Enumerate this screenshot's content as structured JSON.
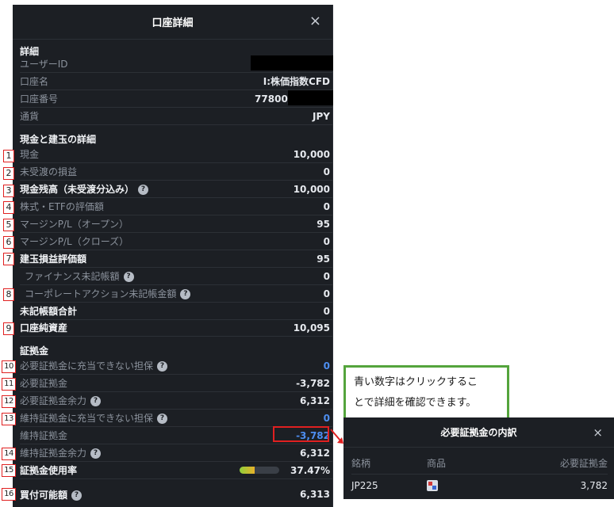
{
  "account_detail": {
    "title": "口座詳細",
    "close_label": "×",
    "sections": {
      "details": "詳細",
      "cash": "現金と建玉の詳細",
      "margin": "証拠金"
    },
    "details_rows": [
      {
        "label": "ユーザーID",
        "value": ""
      },
      {
        "label": "口座名",
        "value": "I:株価指数CFD"
      },
      {
        "label": "口座番号",
        "value": "77800/I1"
      },
      {
        "label": "通貨",
        "value": "JPY"
      }
    ],
    "cash_rows": [
      {
        "badge": "1",
        "label": "現金",
        "value": "10,000"
      },
      {
        "badge": "2",
        "label": "未受渡の損益",
        "value": "0"
      },
      {
        "badge": "3",
        "label": "現金残高（未受渡分込み）",
        "value": "10,000"
      },
      {
        "badge": "4",
        "label": "株式・ETFの評価額",
        "value": "0"
      },
      {
        "badge": "5",
        "label": "マージンP/L（オープン）",
        "value": "95"
      },
      {
        "badge": "6",
        "label": "マージンP/L（クローズ）",
        "value": "0"
      },
      {
        "badge": "7",
        "label": "建玉損益評価額",
        "value": "95"
      },
      {
        "badge": "",
        "label": "ファイナンス未記帳額",
        "value": "0"
      },
      {
        "badge": "8",
        "label": "コーポレートアクション未記帳金額",
        "value": "0"
      },
      {
        "badge": "",
        "label": "未記帳額合計",
        "value": "0"
      },
      {
        "badge": "9",
        "label": "口座純資産",
        "value": "10,095"
      }
    ],
    "margin_rows": [
      {
        "badge": "10",
        "label": "必要証拠金に充当できない担保",
        "value": "0"
      },
      {
        "badge": "11",
        "label": "必要証拠金",
        "value": "-3,782"
      },
      {
        "badge": "12",
        "label": "必要証拠金余力",
        "value": "6,312"
      },
      {
        "badge": "13",
        "label": "維持証拠金に充当できない担保",
        "value": "0"
      },
      {
        "badge": "",
        "label": "維持証拠金",
        "value": "-3,782"
      },
      {
        "badge": "14",
        "label": "維持証拠金余力",
        "value": "6,312"
      },
      {
        "badge": "15",
        "label": "証拠金使用率",
        "value": "37.47%"
      },
      {
        "badge": "16",
        "label": "買付可能額",
        "value": "6,313"
      }
    ],
    "margin_usage_fraction": 0.3747,
    "help_icon": "?"
  },
  "note": {
    "text_line1": "青い数字はクリックするこ",
    "text_line2": "とで詳細を確認できます。"
  },
  "popup": {
    "title": "必要証拠金の内訳",
    "close_label": "×",
    "headers": [
      "銘柄",
      "商品",
      "必要証拠金"
    ],
    "rows": [
      {
        "symbol": "JP225",
        "product_icon": "cfd-icon",
        "margin": "3,782"
      }
    ]
  },
  "colors": {
    "panel_bg": "#1c1f24",
    "link_blue": "#4d8ef0",
    "badge_red": "#e02020",
    "note_border": "#54a43c"
  }
}
